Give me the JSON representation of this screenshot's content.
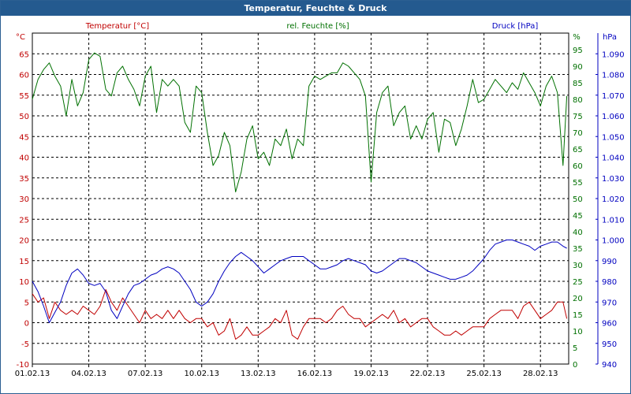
{
  "window": {
    "title": "Temperatur, Feuchte & Druck"
  },
  "chart_data": {
    "type": "line",
    "title": "Temperatur, Feuchte & Druck",
    "colors": {
      "temperature": "#c00000",
      "humidity": "#007000",
      "pressure": "#0000c0",
      "grid": "#000000",
      "title_bg": "#245a8f"
    },
    "grid": true,
    "x_ticks": [
      "01.02.13",
      "04.02.13",
      "07.02.13",
      "10.02.13",
      "13.02.13",
      "16.02.13",
      "19.02.13",
      "22.02.13",
      "25.02.13",
      "28.02.13"
    ],
    "xlim": [
      1,
      29.5
    ],
    "axes": {
      "temperature": {
        "label": "Temperatur [°C]",
        "unit": "°C",
        "ylim": [
          -10,
          70
        ],
        "ticks": [
          "-10",
          "-5",
          "0",
          "5",
          "10",
          "15",
          "20",
          "25",
          "30",
          "35",
          "40",
          "45",
          "50",
          "55",
          "60",
          "65"
        ]
      },
      "humidity": {
        "label": "rel. Feuchte [%]",
        "unit": "%",
        "ylim": [
          0,
          100
        ],
        "ticks": [
          "0",
          "5",
          "10",
          "15",
          "20",
          "25",
          "30",
          "35",
          "40",
          "45",
          "50",
          "55",
          "60",
          "65",
          "70",
          "75",
          "80",
          "85",
          "90",
          "95"
        ]
      },
      "pressure": {
        "label": "Druck [hPa]",
        "unit": "hPa",
        "ylim": [
          940,
          1100
        ],
        "ticks": [
          "940",
          "950",
          "960",
          "970",
          "980",
          "990",
          "1.000",
          "1.010",
          "1.020",
          "1.030",
          "1.040",
          "1.050",
          "1.060",
          "1.070",
          "1.080",
          "1.090"
        ]
      }
    },
    "series": [
      {
        "name": "Temperatur [°C]",
        "axis": "temperature",
        "x": [
          1,
          1.3,
          1.6,
          1.9,
          2.2,
          2.5,
          2.8,
          3.1,
          3.4,
          3.7,
          4.0,
          4.3,
          4.6,
          4.9,
          5.2,
          5.5,
          5.8,
          6.1,
          6.4,
          6.7,
          7.0,
          7.3,
          7.6,
          7.9,
          8.2,
          8.5,
          8.8,
          9.1,
          9.4,
          9.7,
          10.0,
          10.3,
          10.6,
          10.9,
          11.2,
          11.5,
          11.8,
          12.1,
          12.4,
          12.7,
          13.0,
          13.3,
          13.6,
          13.9,
          14.2,
          14.5,
          14.8,
          15.1,
          15.4,
          15.7,
          16.0,
          16.3,
          16.6,
          16.9,
          17.2,
          17.5,
          17.8,
          18.1,
          18.4,
          18.7,
          19.0,
          19.3,
          19.6,
          19.9,
          20.2,
          20.5,
          20.8,
          21.1,
          21.4,
          21.7,
          22.0,
          22.3,
          22.6,
          22.9,
          23.2,
          23.5,
          23.8,
          24.1,
          24.4,
          24.7,
          25.0,
          25.3,
          25.6,
          25.9,
          26.2,
          26.5,
          26.8,
          27.1,
          27.4,
          27.7,
          28.0,
          28.3,
          28.6,
          28.9,
          29.2,
          29.4
        ],
        "y": [
          7,
          5,
          6,
          1,
          5,
          3,
          2,
          3,
          2,
          4,
          3,
          2,
          4,
          8,
          5,
          3,
          6,
          4,
          2,
          0,
          3,
          1,
          2,
          1,
          3,
          1,
          3,
          1,
          0,
          1,
          1,
          -1,
          0,
          -3,
          -2,
          1,
          -4,
          -3,
          -1,
          -3,
          -3,
          -2,
          -1,
          1,
          0,
          3,
          -3,
          -4,
          -1,
          1,
          1,
          1,
          0,
          1,
          3,
          4,
          2,
          1,
          1,
          -1,
          0,
          1,
          2,
          1,
          3,
          0,
          1,
          -1,
          0,
          1,
          1,
          -1,
          -2,
          -3,
          -3,
          -2,
          -3,
          -2,
          -1,
          -1,
          -1,
          1,
          2,
          3,
          3,
          3,
          1,
          4,
          5,
          3,
          1,
          2,
          3,
          5,
          5,
          1
        ]
      },
      {
        "name": "rel. Feuchte [%]",
        "axis": "humidity",
        "x": [
          1,
          1.3,
          1.6,
          1.9,
          2.2,
          2.5,
          2.8,
          3.1,
          3.4,
          3.7,
          4.0,
          4.3,
          4.6,
          4.9,
          5.2,
          5.5,
          5.8,
          6.1,
          6.4,
          6.7,
          7.0,
          7.3,
          7.6,
          7.9,
          8.2,
          8.5,
          8.8,
          9.1,
          9.4,
          9.7,
          10.0,
          10.3,
          10.6,
          10.9,
          11.2,
          11.5,
          11.8,
          12.1,
          12.4,
          12.7,
          13.0,
          13.3,
          13.6,
          13.9,
          14.2,
          14.5,
          14.8,
          15.1,
          15.4,
          15.7,
          16.0,
          16.3,
          16.6,
          16.9,
          17.2,
          17.5,
          17.8,
          18.1,
          18.4,
          18.7,
          19.0,
          19.3,
          19.6,
          19.9,
          20.2,
          20.5,
          20.8,
          21.1,
          21.4,
          21.7,
          22.0,
          22.3,
          22.6,
          22.9,
          23.2,
          23.5,
          23.8,
          24.1,
          24.4,
          24.7,
          25.0,
          25.3,
          25.6,
          25.9,
          26.2,
          26.5,
          26.8,
          27.1,
          27.4,
          27.7,
          28.0,
          28.3,
          28.6,
          28.9,
          29.2,
          29.4
        ],
        "y": [
          80,
          86,
          89,
          91,
          87,
          84,
          75,
          86,
          78,
          82,
          92,
          94,
          93,
          83,
          81,
          88,
          90,
          86,
          83,
          78,
          87,
          90,
          76,
          86,
          84,
          86,
          84,
          73,
          70,
          84,
          82,
          70,
          60,
          63,
          70,
          66,
          52,
          58,
          68,
          72,
          62,
          64,
          60,
          68,
          66,
          71,
          62,
          68,
          66,
          84,
          87,
          86,
          87,
          88,
          88,
          91,
          90,
          88,
          86,
          81,
          55,
          76,
          82,
          84,
          72,
          76,
          78,
          68,
          72,
          68,
          74,
          76,
          64,
          74,
          73,
          66,
          71,
          78,
          86,
          79,
          80,
          83,
          86,
          84,
          82,
          85,
          83,
          88,
          85,
          82,
          78,
          84,
          87,
          82,
          60,
          81
        ],
        "x_extra_note": ""
      },
      {
        "name": "Druck [hPa]",
        "axis": "pressure",
        "x": [
          1,
          1.3,
          1.6,
          1.9,
          2.2,
          2.5,
          2.8,
          3.1,
          3.4,
          3.7,
          4.0,
          4.3,
          4.6,
          4.9,
          5.2,
          5.5,
          5.8,
          6.1,
          6.4,
          6.7,
          7.0,
          7.3,
          7.6,
          7.9,
          8.2,
          8.5,
          8.8,
          9.1,
          9.4,
          9.7,
          10.0,
          10.3,
          10.6,
          10.9,
          11.2,
          11.5,
          11.8,
          12.1,
          12.4,
          12.7,
          13.0,
          13.3,
          13.6,
          13.9,
          14.2,
          14.5,
          14.8,
          15.1,
          15.4,
          15.7,
          16.0,
          16.3,
          16.6,
          16.9,
          17.2,
          17.5,
          17.8,
          18.1,
          18.4,
          18.7,
          19.0,
          19.3,
          19.6,
          19.9,
          20.2,
          20.5,
          20.8,
          21.1,
          21.4,
          21.7,
          22.0,
          22.3,
          22.6,
          22.9,
          23.2,
          23.5,
          23.8,
          24.1,
          24.4,
          24.7,
          25.0,
          25.3,
          25.6,
          25.9,
          26.2,
          26.5,
          26.8,
          27.1,
          27.4,
          27.7,
          28.0,
          28.3,
          28.6,
          28.9,
          29.2,
          29.4
        ],
        "y": [
          980,
          975,
          968,
          960,
          965,
          970,
          978,
          984,
          986,
          983,
          979,
          978,
          979,
          975,
          966,
          962,
          968,
          974,
          978,
          979,
          981,
          983,
          984,
          986,
          987,
          986,
          984,
          980,
          976,
          970,
          968,
          970,
          974,
          980,
          985,
          989,
          992,
          994,
          992,
          990,
          987,
          984,
          986,
          988,
          990,
          991,
          992,
          992,
          992,
          990,
          988,
          986,
          986,
          987,
          988,
          990,
          991,
          990,
          989,
          988,
          985,
          984,
          985,
          987,
          989,
          991,
          991,
          990,
          989,
          987,
          985,
          984,
          983,
          982,
          981,
          981,
          982,
          983,
          985,
          988,
          991,
          995,
          998,
          999,
          1000,
          1000,
          999,
          998,
          997,
          995,
          997,
          998,
          999,
          999,
          997,
          996
        ]
      }
    ]
  }
}
